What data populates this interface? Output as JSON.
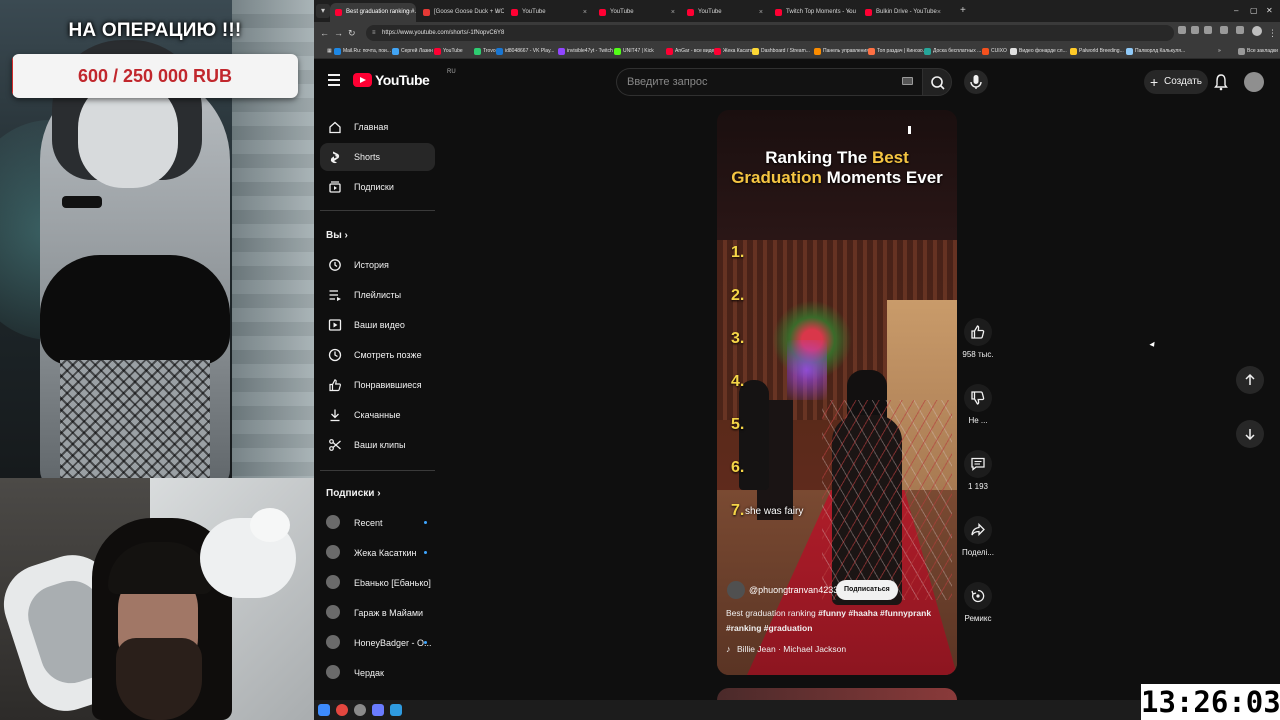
{
  "overlay": {
    "goal_title": "НА ОПЕРАЦИЮ !!!",
    "goal_progress": "600 / 250 000 RUB",
    "goal_current": 600,
    "goal_target": 250000,
    "goal_fill_color": "#d32a2a",
    "goal_text_color": "#c1272d"
  },
  "browser": {
    "tabs": [
      {
        "label": "Best graduation ranking #...",
        "active": true,
        "favicon_color": "#ff0033"
      },
      {
        "label": "[Goose Goose Duck + WOW T...",
        "active": false,
        "favicon_color": "#e53935"
      },
      {
        "label": "YouTube",
        "active": false,
        "favicon_color": "#ff0033"
      },
      {
        "label": "YouTube",
        "active": false,
        "favicon_color": "#ff0033"
      },
      {
        "label": "YouTube",
        "active": false,
        "favicon_color": "#ff0033"
      },
      {
        "label": "Twitch Top Moments - YouTube",
        "active": false,
        "favicon_color": "#ff0033"
      },
      {
        "label": "Bulkin Drive - YouTube",
        "active": false,
        "favicon_color": "#ff0033"
      }
    ],
    "tab_new": "+",
    "window_controls": {
      "minimize": "–",
      "maximize": "▢",
      "close": "✕"
    },
    "address": "https://www.youtube.com/shorts/-1fNopvC6Y8",
    "bookmarks": [
      {
        "label": "Mail.Ru: почта, пои...",
        "color": "#1e88e5"
      },
      {
        "label": "Сергей Лазин",
        "color": "#42a5f5"
      },
      {
        "label": "YouTube",
        "color": "#ff0033"
      },
      {
        "label": "Trovo",
        "color": "#2ecc71"
      },
      {
        "label": "id8048667 - VK Play...",
        "color": "#1976d2"
      },
      {
        "label": "invisible47yt - Twitch",
        "color": "#9146ff"
      },
      {
        "label": "UNIT47 | Kick",
        "color": "#53fc18"
      },
      {
        "label": "AnGar - все видео...",
        "color": "#ff0033"
      },
      {
        "label": "Жека Касаткин",
        "color": "#ff0033"
      },
      {
        "label": "Dashboard / Stream...",
        "color": "#fdd835"
      },
      {
        "label": "Панель управления",
        "color": "#fb8c00"
      },
      {
        "label": "Топ раздач | Кинозо...",
        "color": "#ff7043"
      },
      {
        "label": "Доска бесплатных ...",
        "color": "#26a69a"
      },
      {
        "label": "CUIXO",
        "color": "#f4511e"
      },
      {
        "label": "Видео фонарде сл...",
        "color": "#e0e0e0"
      },
      {
        "label": "Palworld Breeding...",
        "color": "#ffca28"
      },
      {
        "label": "Палворлд Калькуля...",
        "color": "#90caf9"
      }
    ],
    "bookmarks_more": "»",
    "all_bookmarks": "Все закладки"
  },
  "youtube": {
    "logo_text": "YouTube",
    "region": "RU",
    "search_placeholder": "Введите запрос",
    "create_label": "Создать",
    "sidebar_top": [
      {
        "label": "Главная",
        "icon": "home-icon",
        "active": false
      },
      {
        "label": "Shorts",
        "icon": "shorts-icon",
        "active": true
      },
      {
        "label": "Подписки",
        "icon": "subscriptions-icon",
        "active": false
      }
    ],
    "you_heading": "Вы",
    "sidebar_you": [
      {
        "label": "История",
        "icon": "history-icon"
      },
      {
        "label": "Плейлисты",
        "icon": "playlists-icon"
      },
      {
        "label": "Ваши видео",
        "icon": "your-videos-icon"
      },
      {
        "label": "Смотреть позже",
        "icon": "watch-later-icon"
      },
      {
        "label": "Понравившиеся",
        "icon": "liked-icon"
      },
      {
        "label": "Скачанные",
        "icon": "downloads-icon"
      },
      {
        "label": "Ваши клипы",
        "icon": "clips-icon"
      }
    ],
    "subs_heading": "Подписки",
    "subscriptions": [
      {
        "label": "Recent",
        "dot": true
      },
      {
        "label": "Жека Касаткин",
        "dot": true
      },
      {
        "label": "Ebaнько [Ебанько]",
        "dot": false
      },
      {
        "label": "Гараж в Майами",
        "dot": false
      },
      {
        "label": "HoneyBadger - О...",
        "dot": true
      },
      {
        "label": "Чердак",
        "dot": false
      }
    ],
    "short": {
      "title_prefix": "Ranking The ",
      "title_highlight1": "Best",
      "title_highlight2": "Graduation",
      "title_suffix": " Moments Ever",
      "ranks": [
        "1.",
        "2.",
        "3.",
        "4.",
        "5.",
        "6.",
        "7."
      ],
      "caption": "she was fairy",
      "channel": "@phuongtranvan4233",
      "subscribe": "Подписаться",
      "description_plain": "Best graduation ranking ",
      "description_tags": "#funny #haaha #funnyprank #ranking #graduation",
      "music": "Billie Jean · Michael Jackson"
    },
    "actions": [
      {
        "name": "like",
        "count": "958 тыс."
      },
      {
        "name": "dislike",
        "count": "Не ..."
      },
      {
        "name": "comments",
        "count": "1 193"
      },
      {
        "name": "share",
        "count": "Поделі..."
      },
      {
        "name": "remix",
        "count": "Ремикс"
      }
    ]
  },
  "clock": "13:26:03"
}
